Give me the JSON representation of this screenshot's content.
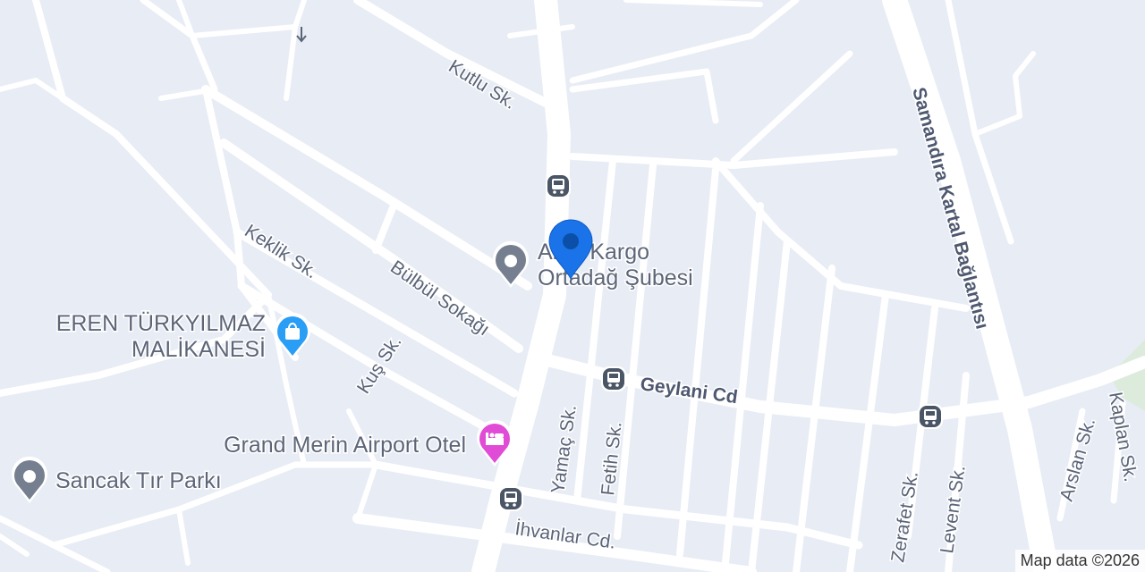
{
  "map": {
    "colors": {
      "background": "#e8ecf5",
      "road": "#ffffff",
      "park": "#dcebdc",
      "street_label": "#5a6478",
      "selected_pin": "#1a73e8",
      "generic_poi": "#757f8f",
      "shopping_poi": "#2a9df4",
      "hotel_poi": "#e04cd6",
      "transit_icon": "#4a5565"
    },
    "streets": [
      "Kutlu Sk.",
      "Keklik Sk.",
      "Bülbül Sokağı",
      "Kuş Sk.",
      "Geylani Cd",
      "Yamaç Sk.",
      "Fetih Sk.",
      "İhvanlar Cd.",
      "Samandıra Kartal Bağlantısı",
      "Zerafet Sk.",
      "Levent Sk.",
      "Arslan Sk.",
      "Kaplan Sk."
    ],
    "pois": {
      "selected": {
        "label_line1": "Aras Kargo",
        "label_line2": "Ortadağ Şubesi",
        "icon": "map-pin-icon"
      },
      "eren": {
        "label_line1": "EREN TÜRKYILMAZ",
        "label_line2": "MALİKANESİ",
        "icon": "shopping-bag-icon"
      },
      "hotel": {
        "label": "Grand Merin Airport Otel",
        "icon": "bed-icon"
      },
      "sancak": {
        "label": "Sancak Tır Parkı",
        "icon": "generic-poi-icon"
      }
    },
    "transit": {
      "icon": "bus-stop-icon"
    },
    "attribution": "Map data ©2026"
  }
}
